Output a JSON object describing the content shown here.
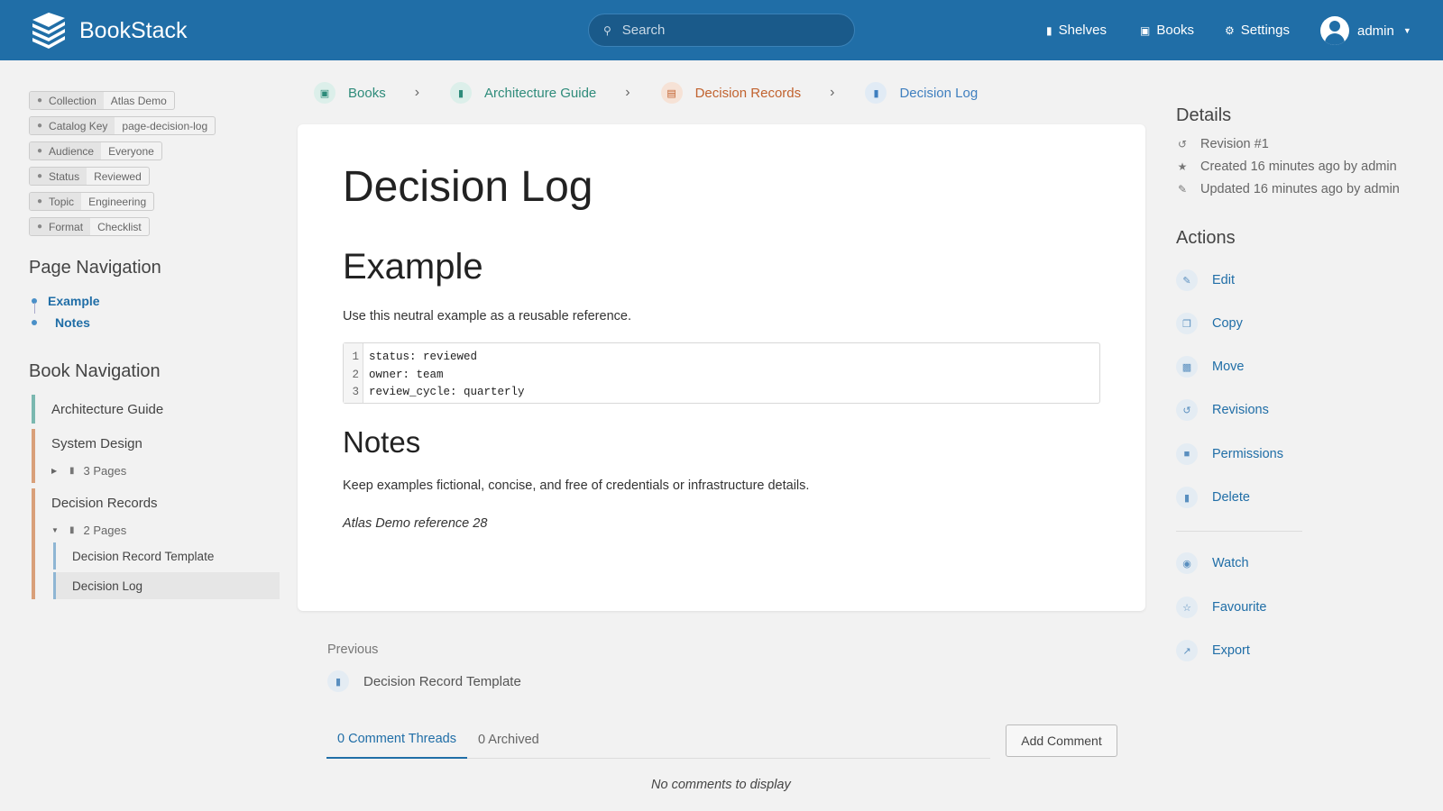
{
  "app": {
    "name": "BookStack"
  },
  "header": {
    "search_placeholder": "Search",
    "nav": [
      {
        "label": "Shelves",
        "icon": "shelves-icon"
      },
      {
        "label": "Books",
        "icon": "books-icon"
      },
      {
        "label": "Settings",
        "icon": "gear-icon"
      }
    ],
    "user": {
      "name": "admin"
    }
  },
  "tags": [
    {
      "key": "Collection",
      "value": "Atlas Demo"
    },
    {
      "key": "Catalog Key",
      "value": "page-decision-log"
    },
    {
      "key": "Audience",
      "value": "Everyone"
    },
    {
      "key": "Status",
      "value": "Reviewed"
    },
    {
      "key": "Topic",
      "value": "Engineering"
    },
    {
      "key": "Format",
      "value": "Checklist"
    }
  ],
  "page_navigation": {
    "title": "Page Navigation",
    "items": [
      "Example",
      "Notes"
    ]
  },
  "book_navigation": {
    "title": "Book Navigation",
    "book": "Architecture Guide",
    "chapters": [
      {
        "title": "System Design",
        "pages_label": "3 Pages",
        "expanded": false
      },
      {
        "title": "Decision Records",
        "pages_label": "2 Pages",
        "expanded": true,
        "pages": [
          "Decision Record Template",
          "Decision Log"
        ],
        "active": "Decision Log"
      }
    ]
  },
  "breadcrumb": [
    {
      "label": "Books",
      "color": "#2e8b7a",
      "bg": "#dcefea"
    },
    {
      "label": "Architecture Guide",
      "color": "#2e8b7a",
      "bg": "#dcefea"
    },
    {
      "label": "Decision Records",
      "color": "#c1622e",
      "bg": "#f6e2d6"
    },
    {
      "label": "Decision Log",
      "color": "#3f7fbf",
      "bg": "#e1ebf5"
    }
  ],
  "content": {
    "title": "Decision Log",
    "section1_heading": "Example",
    "section1_text": "Use this neutral example as a reusable reference.",
    "code_line_numbers": [
      "1",
      "2",
      "3"
    ],
    "code_lines": [
      "status: reviewed",
      "owner: team",
      "review_cycle: quarterly"
    ],
    "section2_heading": "Notes",
    "section2_text": "Keep examples fictional, concise, and free of credentials or infrastructure details.",
    "italic_note": "Atlas Demo reference 28"
  },
  "previous": {
    "label": "Previous",
    "page": "Decision Record Template"
  },
  "comments": {
    "tab_active": "0 Comment Threads",
    "tab_archived": "0 Archived",
    "add_button": "Add Comment",
    "empty": "No comments to display"
  },
  "details": {
    "title": "Details",
    "revision": "Revision #1",
    "created": "Created 16 minutes ago by admin",
    "updated": "Updated 16 minutes ago by admin"
  },
  "actions": {
    "title": "Actions",
    "primary": [
      {
        "label": "Edit",
        "icon": "pencil-icon"
      },
      {
        "label": "Copy",
        "icon": "copy-icon"
      },
      {
        "label": "Move",
        "icon": "folder-icon"
      },
      {
        "label": "Revisions",
        "icon": "history-icon"
      },
      {
        "label": "Permissions",
        "icon": "lock-icon"
      },
      {
        "label": "Delete",
        "icon": "trash-icon"
      }
    ],
    "secondary": [
      {
        "label": "Watch",
        "icon": "eye-icon"
      },
      {
        "label": "Favourite",
        "icon": "star-icon"
      },
      {
        "label": "Export",
        "icon": "export-icon"
      }
    ]
  },
  "colors": {
    "header": "#206ea7",
    "link": "#206ea7",
    "book_accent": "#7bb8b0",
    "chapter_accent": "#d9a07a",
    "page_accent": "#8fb6d4"
  }
}
